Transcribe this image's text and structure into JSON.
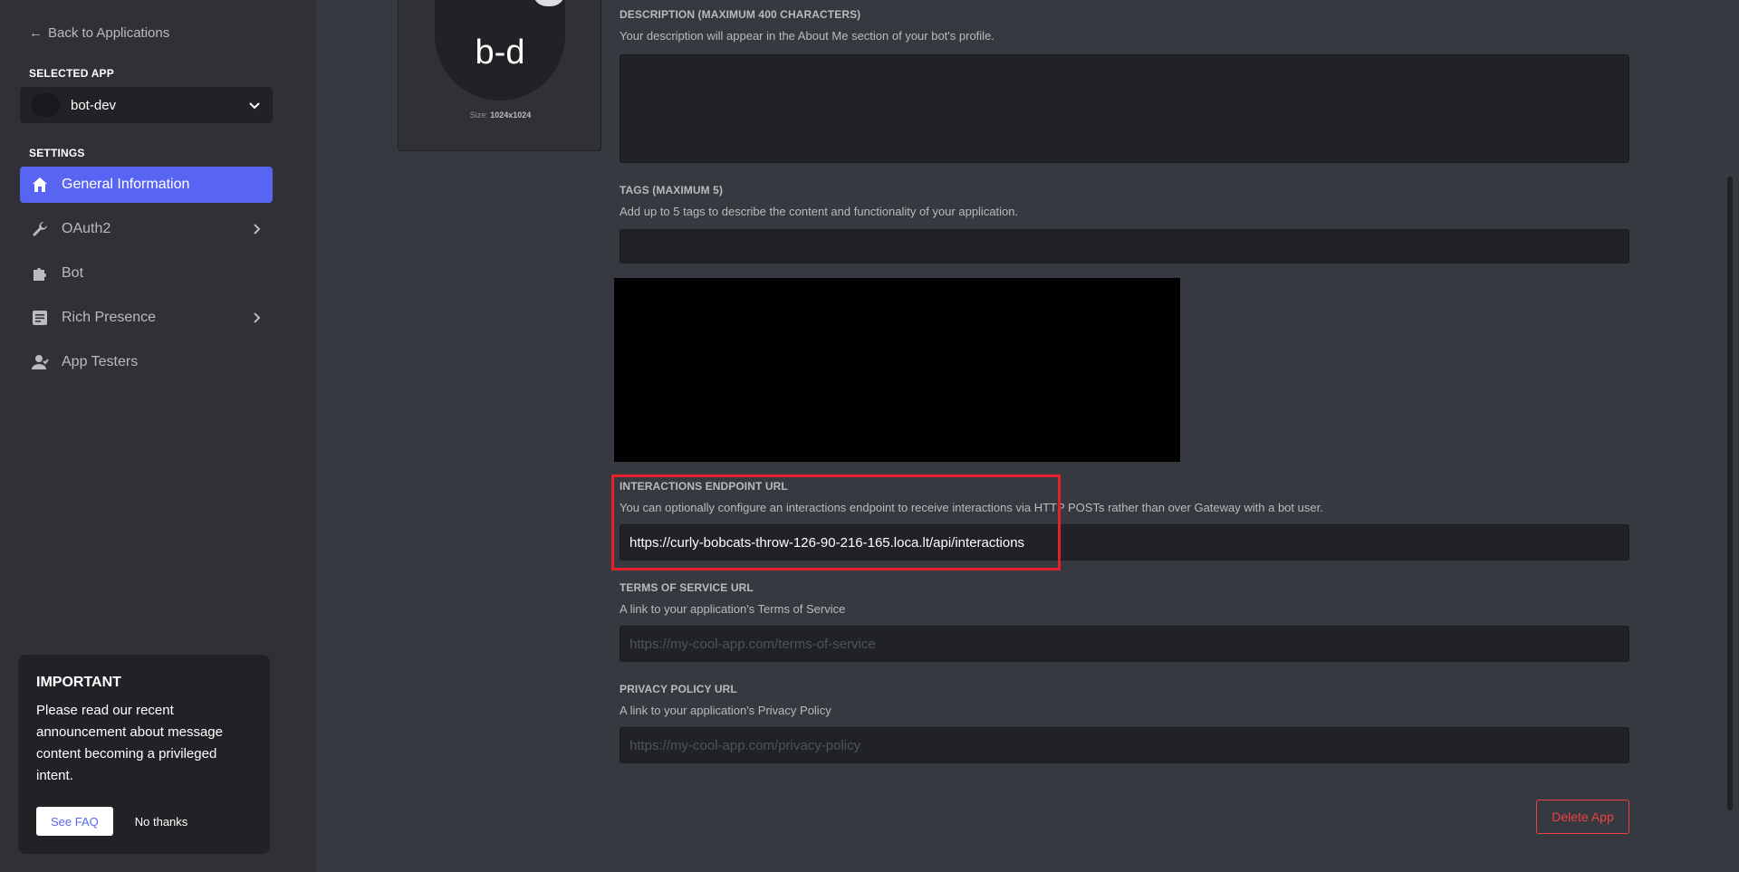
{
  "sidebar": {
    "back_label": "Back to Applications",
    "selected_app_heading": "SELECTED APP",
    "selected_app": "bot-dev",
    "settings_heading": "SETTINGS",
    "items": [
      {
        "label": "General Information",
        "icon": "home-icon",
        "active": true
      },
      {
        "label": "OAuth2",
        "icon": "wrench-icon",
        "has_submenu": true
      },
      {
        "label": "Bot",
        "icon": "puzzle-icon"
      },
      {
        "label": "Rich Presence",
        "icon": "document-icon",
        "has_submenu": true
      },
      {
        "label": "App Testers",
        "icon": "person-icon"
      }
    ]
  },
  "notice": {
    "title": "IMPORTANT",
    "body": "Please read our recent announcement about message content becoming a privileged intent.",
    "faq_label": "See FAQ",
    "dismiss_label": "No thanks"
  },
  "avatar": {
    "initials": "b-d",
    "size_prefix": "Size:",
    "size_value": "1024x1024"
  },
  "fields": {
    "description": {
      "label": "DESCRIPTION (MAXIMUM 400 CHARACTERS)",
      "help": "Your description will appear in the About Me section of your bot's profile.",
      "value": ""
    },
    "tags": {
      "label": "TAGS (MAXIMUM 5)",
      "help": "Add up to 5 tags to describe the content and functionality of your application.",
      "value": ""
    },
    "interactions": {
      "label": "INTERACTIONS ENDPOINT URL",
      "help": "You can optionally configure an interactions endpoint to receive interactions via HTTP POSTs rather than over Gateway with a bot user.",
      "value": "https://curly-bobcats-throw-126-90-216-165.loca.lt/api/interactions"
    },
    "tos": {
      "label": "TERMS OF SERVICE URL",
      "help": "A link to your application's Terms of Service",
      "placeholder": "https://my-cool-app.com/terms-of-service"
    },
    "privacy": {
      "label": "PRIVACY POLICY URL",
      "help": "A link to your application's Privacy Policy",
      "placeholder": "https://my-cool-app.com/privacy-policy"
    }
  },
  "delete_label": "Delete App",
  "colors": {
    "accent": "#5865f2",
    "danger": "#ed4245",
    "highlight": "#e5202a"
  }
}
